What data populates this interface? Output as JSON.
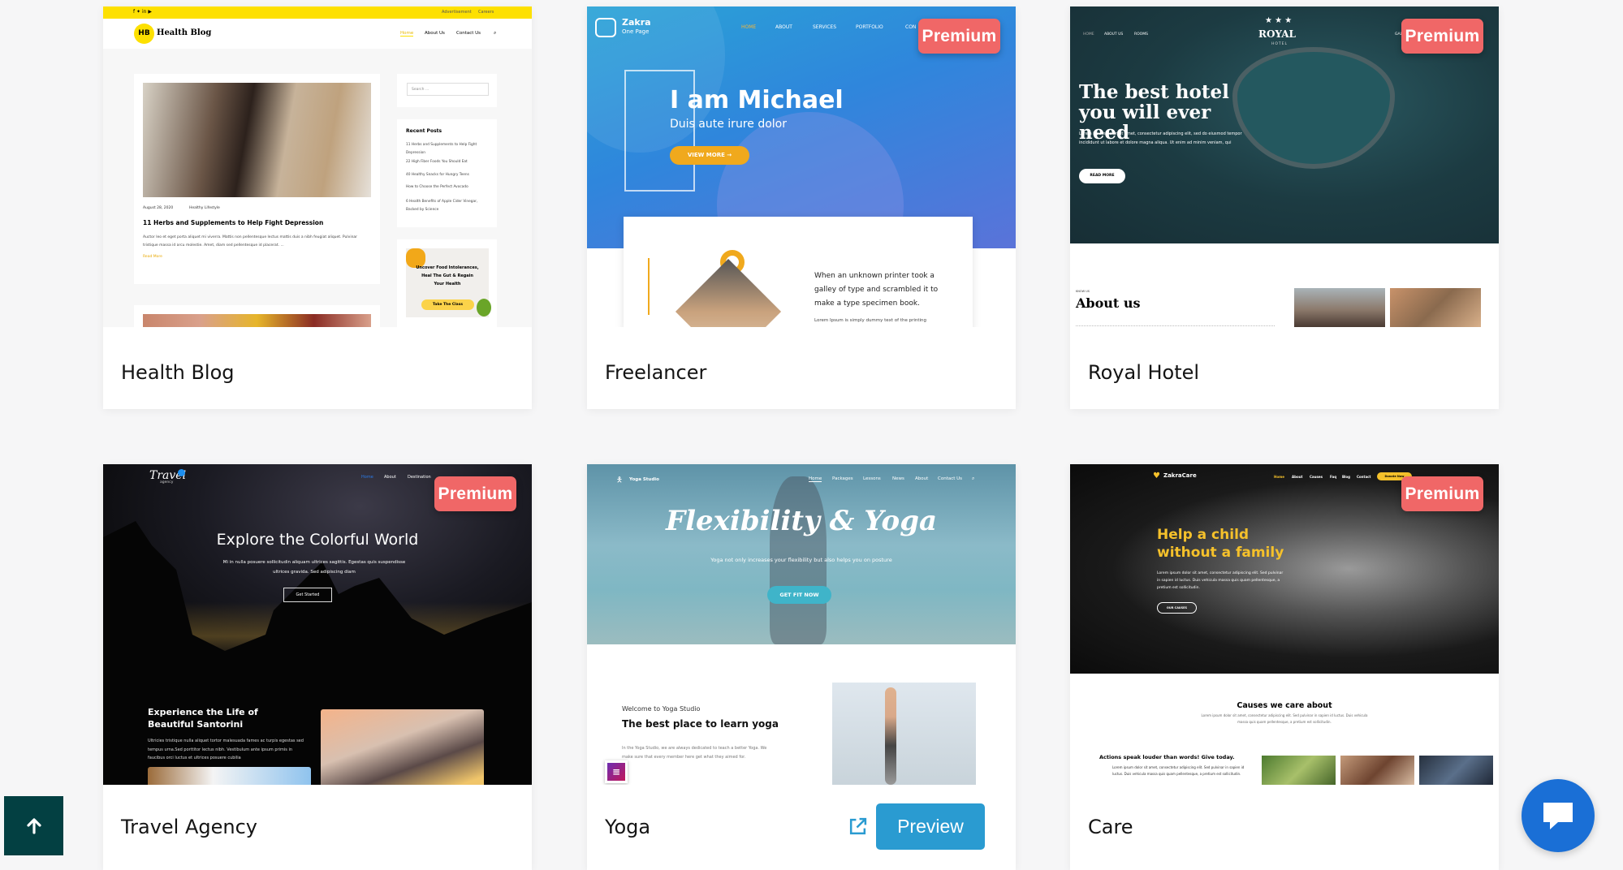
{
  "colors": {
    "page_bg": "#f6f6f7",
    "premium": "#f06767",
    "preview": "#2a9bd1",
    "back_to_top": "#034042",
    "chat": "#1a6fd6"
  },
  "premium_label": "Premium",
  "cards": [
    {
      "title": "Health Blog",
      "premium": false,
      "thumb": {
        "top_links": [
          "Advertisement",
          "Careers"
        ],
        "logo_mark": "HB",
        "logo_text": "Health Blog",
        "nav": [
          "Home",
          "About Us",
          "Contact Us"
        ],
        "post_date": "August 28, 2020",
        "post_category": "Healthy Lifestyle",
        "post_title": "11 Herbs and Supplements to Help Fight Depression",
        "post_excerpt": "Auctor leo et eget porta aliquet mi viverra. Mattis non pellentesque lectus mattis duis a nibh feugiat aliquet. Pulvinar tristique massa id arcu molestie. Amet, diam sed pellentesque id placerat. ...",
        "read_more": "Read More",
        "search_placeholder": "Search ...",
        "recent_heading": "Recent Posts",
        "recent_posts": [
          "11 Herbs and Supplements to Help Fight Depression",
          "22 High Fiber Foods You Should Eat",
          "40 Healthy Snacks for Hungry Teens",
          "How to Choose the Perfect Avocado",
          "6 Health Benefits of Apple Cider Vinegar, Backed by Science"
        ],
        "ad_text": "Uncover Food Intolerances, Heal The Gut & Regain Your Health",
        "ad_button": "Take The Class"
      }
    },
    {
      "title": "Freelancer",
      "premium": true,
      "thumb": {
        "logo_text": "Zakra",
        "logo_sub": "One Page",
        "nav": [
          "HOME",
          "ABOUT",
          "SERVICES",
          "PORTFOLIO",
          "CON"
        ],
        "heading": "I am Michael",
        "subheading": "Duis aute irure dolor",
        "button": "VIEW MORE →",
        "body": "When an unknown printer took a galley of type and scrambled it to make a type specimen book.",
        "body_small": "Lorem Ipsum is simply dummy text of the printing"
      }
    },
    {
      "title": "Royal Hotel",
      "premium": true,
      "thumb": {
        "nav": [
          "HOME",
          "ABOUT US",
          "ROOMS",
          "GAL"
        ],
        "logo_stars": "★ ★ ★",
        "logo_text": "ROYAL",
        "logo_sub": "HOTEL",
        "heading": "The best hotel you will ever need",
        "body": "Lorem ipsum dolor sit amet, consectetur adipiscing elit, sed do eiusmod tempor incididunt ut labore et dolore magna aliqua. Ut enim ad minim veniam, qui",
        "button": "READ MORE",
        "kicker": "KNOW US",
        "section_title": "About us"
      }
    },
    {
      "title": "Travel Agency",
      "premium": true,
      "thumb": {
        "logo_text": "Travel",
        "logo_sub": "agency",
        "nav": [
          "Home",
          "About",
          "Destination"
        ],
        "heading": "Explore the Colorful World",
        "body": "Mi in nulla posuere sollicitudin aliquam ultrices sagittis. Egestas quis suspendisse ultrices gravida. Sed adipiscing diam",
        "button": "Get Started",
        "section_title": "Experience the Life of Beautiful Santorini",
        "section_body": "Ultricies tristique nulla aliquet tortor malesuada fames ac turpis egestas sed tempus urna.Sed porttitor lectus nibh. Vestibulum ante ipsum primis in faucibus orci luctus et ultrices posuere cubilia"
      }
    },
    {
      "title": "Yoga",
      "premium": false,
      "open_icon": "external-link-icon",
      "preview_label": "Preview",
      "thumb": {
        "logo_text": "Yoga Studio",
        "nav": [
          "Home",
          "Packages",
          "Lessons",
          "News",
          "About",
          "Contact Us"
        ],
        "heading": "Flexibility & Yoga",
        "body": "Yoga not only increases your flexibility but also helps you on posture",
        "button": "GET FIT NOW",
        "kicker": "Welcome to Yoga Studio",
        "section_title": "The best place to learn yoga",
        "section_body": "In the Yoga Studio, we are always dedicated to teach a better Yoga. We make sure that every member here get what they aimed for."
      }
    },
    {
      "title": "Care",
      "premium": true,
      "thumb": {
        "logo_text": "ZakraCare",
        "nav": [
          "Home",
          "About",
          "Causes",
          "Faq",
          "Blog",
          "Contact"
        ],
        "nav_button": "Donate Now",
        "heading": "Help a child without a family",
        "body": "Lorem ipsum dolor sit amet, consectetur adipiscing elit. Sed pulvinar in sapien id luctus. Duis vehicula massa quis quam pellentesque, a pretium est sollicitudin.",
        "button": "OUR CAUSES",
        "section_title": "Causes we care about",
        "section_body": "Lorem ipsum dolor sit amet, consectetur adipiscing elit. Sed pulvinar in sapien id luctus. Duis vehicula massa quis quam pellentesque, a pretium est sollicitudin.",
        "sub_title": "Actions speak louder than words! Give today.",
        "sub_body": "Lorem ipsum dolor sit amet, consectetur adipiscing elit. Sed pulvinar in sapien id luctus. Duis vehicula massa quis quam pellentesque, a pretium est sollicitudin."
      }
    }
  ]
}
